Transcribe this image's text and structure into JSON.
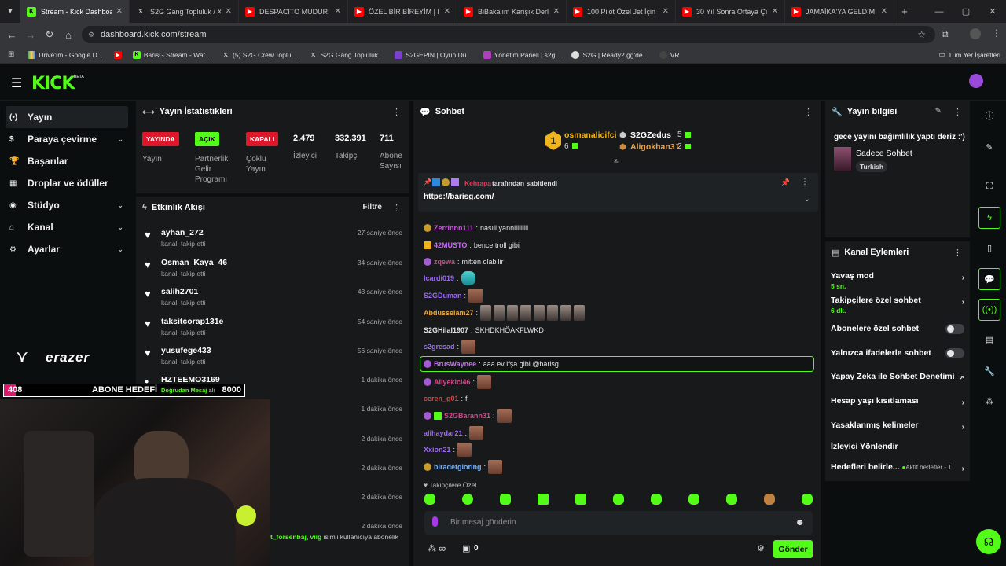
{
  "browser": {
    "tabs": [
      {
        "label": "Stream - Kick Dashboard",
        "icon": "kick-icon",
        "active": true
      },
      {
        "label": "S2G Gang Topluluk / X",
        "icon": "x-icon"
      },
      {
        "label": "DESPACITO MUDUR PEKİ",
        "icon": "youtube-icon"
      },
      {
        "label": "ÖZEL BİR BİREYİM | Mada",
        "icon": "youtube-icon"
      },
      {
        "label": "BiBakalım Karışık Derleme",
        "icon": "youtube-icon"
      },
      {
        "label": "100 Pilot Özel Jet İçin Mü",
        "icon": "youtube-icon"
      },
      {
        "label": "30 Yıl Sonra Ortaya Çıkan",
        "icon": "youtube-icon"
      },
      {
        "label": "JAMAİKA'YA GELDİM - Ya",
        "icon": "youtube-icon"
      }
    ],
    "new_tab": "+",
    "url": "dashboard.kick.com/stream",
    "bookmarks": [
      {
        "label": "Drive'ım - Google D...",
        "icon": "drive-icon"
      },
      {
        "label": "",
        "icon": "youtube-icon"
      },
      {
        "label": "BarisG Stream - Wat...",
        "icon": "kick-icon"
      },
      {
        "label": "(5) S2G Crew Toplul...",
        "icon": "x-icon"
      },
      {
        "label": "S2G Gang Topluluk...",
        "icon": "x-icon"
      },
      {
        "label": "S2GEPIN | Oyun Dü...",
        "icon": "s2g-icon"
      },
      {
        "label": "Yönetim Paneli | s2g...",
        "icon": "panel-icon"
      },
      {
        "label": "S2G | Ready2.gg'de...",
        "icon": "ready-icon"
      },
      {
        "label": "VR",
        "icon": "vr-icon"
      }
    ],
    "all_bookmarks": "Tüm Yer İşaretleri"
  },
  "kick": {
    "logo": "KICK",
    "beta": "BETA"
  },
  "sidebar": {
    "items": [
      {
        "label": "Yayın",
        "icon": "broadcast-icon"
      },
      {
        "label": "Paraya çevirme",
        "icon": "money-icon"
      },
      {
        "label": "Başarılar",
        "icon": "trophy-icon"
      },
      {
        "label": "Droplar ve ödüller",
        "icon": "gift-icon"
      },
      {
        "label": "Stüdyo",
        "icon": "studio-icon"
      },
      {
        "label": "Kanal",
        "icon": "channel-icon"
      },
      {
        "label": "Ayarlar",
        "icon": "gear-icon"
      }
    ],
    "brand": "erazer"
  },
  "stats": {
    "title": "Yayın İstatistikleri",
    "live_badge": "YAYINDA",
    "live_label": "Yayın",
    "partner_badge": "AÇIK",
    "partner_label": "Partnerlik Gelir Programı",
    "multi_badge": "KAPALI",
    "multi_label": "Çoklu Yayın",
    "viewers": "2.479",
    "viewers_label": "İzleyici",
    "followers": "332.391",
    "followers_label": "Takipçi",
    "subs": "711",
    "subs_label": "Abone Sayısı"
  },
  "activity": {
    "title": "Etkinlik Akışı",
    "filter": "Filtre",
    "items": [
      {
        "user": "ayhan_272",
        "action": "kanalı takip etti",
        "time": "27 saniye önce"
      },
      {
        "user": "Osman_Kaya_46",
        "action": "kanalı takip etti",
        "time": "34 saniye önce"
      },
      {
        "user": "salih2701",
        "action": "kanalı takip etti",
        "time": "43 saniye önce"
      },
      {
        "user": "taksitcorap131e",
        "action": "kanalı takip etti",
        "time": "54 saniye önce"
      },
      {
        "user": "yusufege433",
        "action": "kanalı takip etti",
        "time": "56 saniye önce"
      },
      {
        "user": "HZTEEMO3169",
        "action": "",
        "time": "1 dakika önce"
      },
      {
        "user": "",
        "action": "",
        "time": "1 dakika önce"
      },
      {
        "user": "",
        "action": "",
        "time": "2 dakika önce"
      },
      {
        "user": "",
        "action": "",
        "time": "2 dakika önce"
      },
      {
        "user": "",
        "action": "",
        "time": "2 dakika önce"
      },
      {
        "user": "",
        "action": "",
        "time": "2 dakika önce"
      }
    ],
    "sub_notice_user": "t_forsenbaj, viig",
    "sub_notice_text": "isimli kullanıcıya abonelik"
  },
  "overlay": {
    "count": "408",
    "goal_label": "ABONE HEDEFİ",
    "goal_value": "8000",
    "dm_label": "Doğrudan Mesaj",
    "dm_suffix": "alı"
  },
  "chat": {
    "title": "Sohbet",
    "leaders": [
      {
        "name": "osmanalicifci",
        "count": "6",
        "rank": "1"
      },
      {
        "name": "S2GZedus",
        "count": "5"
      },
      {
        "name": "Aligokhan31",
        "count": "2"
      }
    ],
    "pinned_by_user": "Kehrapa",
    "pinned_by_text": "tarafından sabitlendi",
    "pinned_link": "https://barisg.com/",
    "messages": [
      {
        "user": "Zerrinnn111",
        "color": "#c55dd6",
        "text": "nasıll yanniiiiiiiii"
      },
      {
        "user": "42MUSTO",
        "color": "#c56cf0",
        "text": "bence troll gibi"
      },
      {
        "user": "zqewa",
        "color": "#d14a8a",
        "text": "mitten olabilir"
      },
      {
        "user": "Icardi019",
        "color": "#9b6cf0",
        "text": ""
      },
      {
        "user": "S2GDuman",
        "color": "#9b6cf0",
        "text": ""
      },
      {
        "user": "Abdusselam27",
        "color": "#f0a93c",
        "text": ""
      },
      {
        "user": "S2GHilal1907",
        "color": "#e6e6e6",
        "text": "SKHDKHÖAKFLWKD"
      },
      {
        "user": "s2gresad",
        "color": "#9b6cf0",
        "text": ""
      },
      {
        "user": "BrusWaynee",
        "color": "#c56cf0",
        "text": "aaa ev ifşa gibi @barisg"
      },
      {
        "user": "Aliyekici46",
        "color": "#d14a8a",
        "text": ""
      },
      {
        "user": "ceren_g01",
        "color": "#d14a4a",
        "text": "f"
      },
      {
        "user": "S2GBarann31",
        "color": "#d14a8a",
        "text": ""
      },
      {
        "user": "alihaydar21",
        "color": "#9b6cf0",
        "text": ""
      },
      {
        "user": "Xxion21",
        "color": "#9b6cf0",
        "text": ""
      },
      {
        "user": "biradetgloring",
        "color": "#7ab0f0",
        "text": ""
      }
    ],
    "follower_only_label": "Takipçilere Özel",
    "input_placeholder": "Bir mesaj gönderin",
    "points": "∞",
    "gift_count": "0",
    "send": "Gönder"
  },
  "stream_info": {
    "title": "Yayın bilgisi",
    "stream_title": "gece yayını bağımlılık yaptı deriz :')",
    "category": "Sadece Sohbet",
    "language": "Turkish"
  },
  "channel_actions": {
    "title": "Kanal Eylemleri",
    "slow_mode": "Yavaş mod",
    "slow_value": "5 sn.",
    "followers_only": "Takipçilere özel sohbet",
    "followers_value": "6 dk.",
    "subs_only": "Abonelere özel sohbet",
    "emote_only": "Yalnızca ifadelerle sohbet",
    "ai_moderation": "Yapay Zeka ile Sohbet Denetimi",
    "account_age": "Hesap yaşı kısıtlaması",
    "banned_words": "Yasaklanmış kelimeler",
    "viewer_redirect": "İzleyici Yönlendir",
    "goals": "Hedefleri belirle...",
    "goals_value": "Aktif hedefler - 1"
  },
  "colors": {
    "brand": "#53fc18",
    "live": "#e0162b",
    "panel": "#17191b",
    "background": "#0b0e0f"
  }
}
